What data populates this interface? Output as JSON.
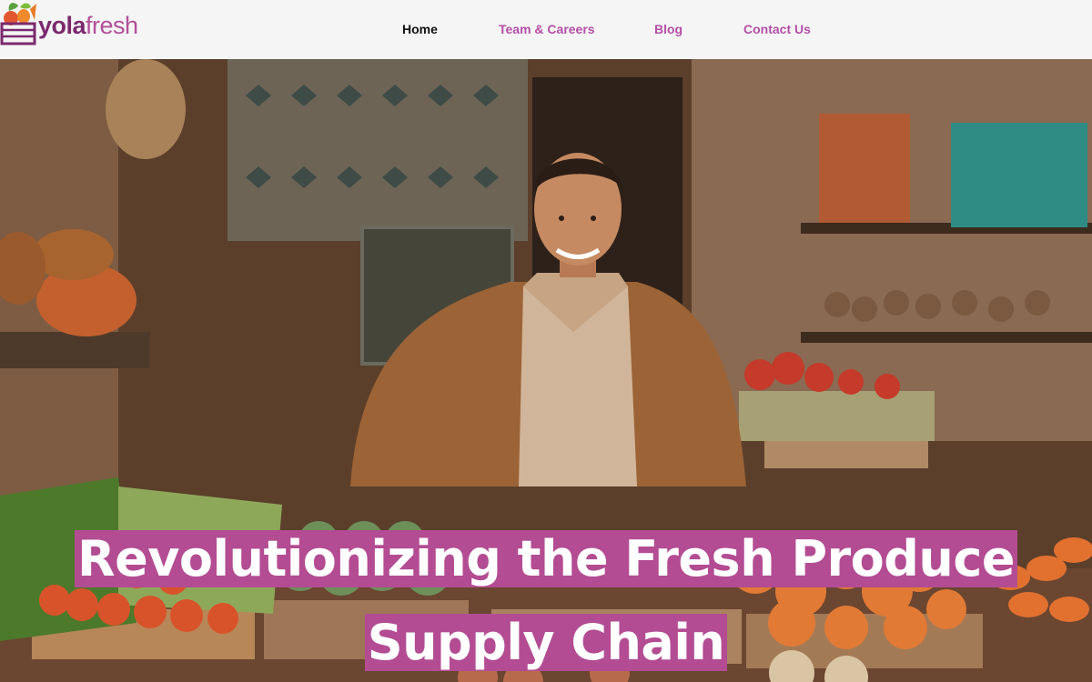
{
  "brand": {
    "name_part1": "yola",
    "name_part2": "fresh",
    "accent_color": "#b34c93",
    "dark_brand_color": "#7a2a6e"
  },
  "nav": {
    "items": [
      {
        "label": "Home",
        "active": true
      },
      {
        "label": "Team & Careers",
        "active": false
      },
      {
        "label": "Blog",
        "active": false
      },
      {
        "label": "Contact Us",
        "active": false
      }
    ]
  },
  "hero": {
    "headline_line1": "Revolutionizing the Fresh Produce",
    "headline_line2": "Supply Chain",
    "image_icon": "market-vendor-photo"
  }
}
